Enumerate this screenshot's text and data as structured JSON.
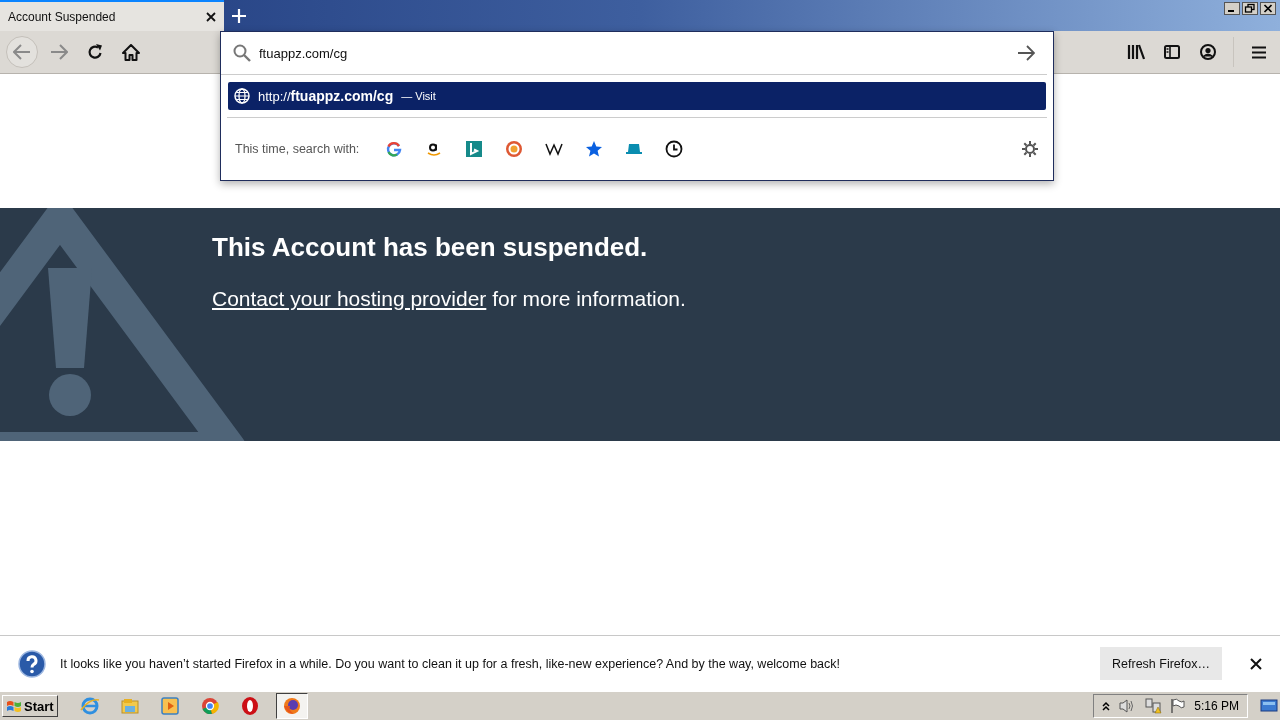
{
  "tab": {
    "title": "Account Suspended",
    "selected": true
  },
  "url_popup": {
    "value": "ftuappz.com/cg",
    "result": {
      "url": "http://**ftuappz.com/cg**",
      "action": "— Visit",
      "selected": true
    },
    "search_label": "This time, search with:",
    "engines": [
      {
        "kind": "google"
      },
      {
        "kind": "amazon"
      },
      {
        "kind": "bing"
      },
      {
        "kind": "duckduckgo"
      },
      {
        "kind": "wikipedia"
      },
      {
        "kind": "bookmarks"
      },
      {
        "kind": "tabs"
      },
      {
        "kind": "history"
      }
    ]
  },
  "page": {
    "heading": "This Account has been suspended.",
    "link": "Contact your hosting provider",
    "rest": " for more information."
  },
  "notification": {
    "message": "It looks like you haven’t started Firefox in a while. Do you want to clean it up for a fresh, like-new experience? And by the way, welcome back!",
    "button": "Refresh Firefox…"
  },
  "taskbar": {
    "start": "Start",
    "apps": [
      {
        "kind": "ie",
        "selected": false
      },
      {
        "kind": "explorer",
        "selected": false
      },
      {
        "kind": "media",
        "selected": false
      },
      {
        "kind": "chrome",
        "selected": false
      },
      {
        "kind": "opera",
        "selected": false
      },
      {
        "kind": "firefox",
        "selected": true
      }
    ],
    "clock": "5:16 PM"
  }
}
